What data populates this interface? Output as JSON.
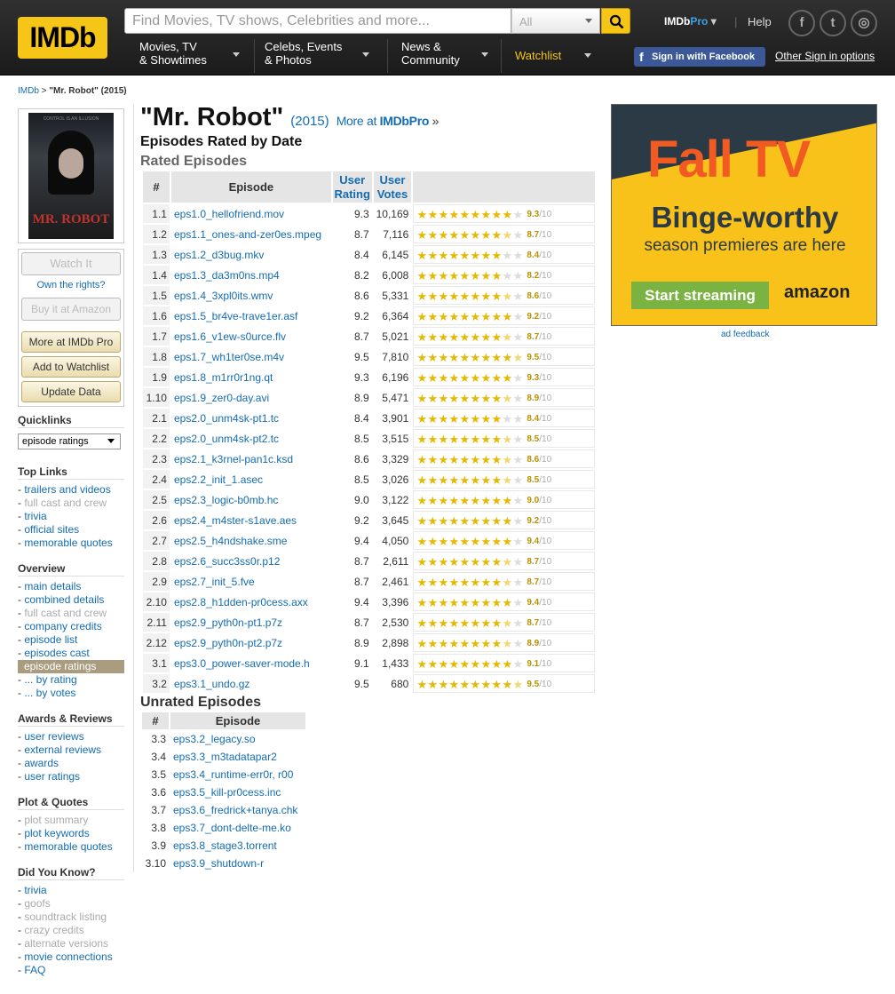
{
  "header": {
    "logo": "IMDb",
    "search_placeholder": "Find Movies, TV shows, Celebrities and more...",
    "search_category": "All",
    "nav": [
      {
        "line1": "Movies, TV",
        "line2": "& Showtimes"
      },
      {
        "line1": "Celebs, Events",
        "line2": "& Photos"
      },
      {
        "line1": "News &",
        "line2": "Community"
      },
      {
        "line1": "Watchlist",
        "line2": ""
      }
    ],
    "pro_a": "IMDb",
    "pro_b": "Pro",
    "help": "Help",
    "facebook_signin": "Sign in with Facebook",
    "other_signin": "Other Sign in options",
    "brand_color": "#f5c518"
  },
  "breadcrumb": {
    "home": "IMDb",
    "sep": " > ",
    "current": "\"Mr. Robot\" (2015)"
  },
  "poster": {
    "title": "MR. ROBOT",
    "tagline": "CONTROL IS AN ILLUSION"
  },
  "sidebar": {
    "watch_it": "Watch It",
    "own_rights": "Own the rights?",
    "buy_amazon": "Buy it at Amazon",
    "more_pro": "More at IMDb Pro",
    "add_watchlist": "Add to Watchlist",
    "update_data": "Update Data",
    "quicklinks_title": "Quicklinks",
    "quicklinks_value": "episode ratings",
    "top_links_title": "Top Links",
    "top_links": [
      {
        "label": "trailers and videos",
        "dim": false
      },
      {
        "label": "full cast and crew",
        "dim": true
      },
      {
        "label": "trivia",
        "dim": false
      },
      {
        "label": "official sites",
        "dim": false
      },
      {
        "label": "memorable quotes",
        "dim": false
      }
    ],
    "overview_title": "Overview",
    "overview": [
      {
        "label": "main details",
        "dim": false
      },
      {
        "label": "combined details",
        "dim": false
      },
      {
        "label": "full cast and crew",
        "dim": true
      },
      {
        "label": "company credits",
        "dim": false
      },
      {
        "label": "episode list",
        "dim": false
      },
      {
        "label": "episodes cast",
        "dim": false
      },
      {
        "label": "episode ratings",
        "dim": false,
        "selected": true
      },
      {
        "label": "... by rating",
        "dim": false,
        "indent": true
      },
      {
        "label": "... by votes",
        "dim": false,
        "indent": true
      }
    ],
    "awards_title": "Awards & Reviews",
    "awards": [
      {
        "label": "user reviews",
        "dim": false
      },
      {
        "label": "external reviews",
        "dim": false
      },
      {
        "label": "awards",
        "dim": false
      },
      {
        "label": "user ratings",
        "dim": false
      }
    ],
    "plot_title": "Plot & Quotes",
    "plot": [
      {
        "label": "plot summary",
        "dim": true
      },
      {
        "label": "plot keywords",
        "dim": false
      },
      {
        "label": "memorable quotes",
        "dim": false
      }
    ],
    "dyk_title": "Did You Know?",
    "dyk": [
      {
        "label": "trivia",
        "dim": false
      },
      {
        "label": "goofs",
        "dim": true
      },
      {
        "label": "soundtrack listing",
        "dim": true
      },
      {
        "label": "crazy credits",
        "dim": true
      },
      {
        "label": "alternate versions",
        "dim": true
      },
      {
        "label": "movie connections",
        "dim": false
      },
      {
        "label": "FAQ",
        "dim": false
      }
    ]
  },
  "main": {
    "title": "\"Mr. Robot\"",
    "year": "(2015)",
    "more_at": "More at ",
    "more_pro": "IMDbPro",
    "more_arrow": " »",
    "subtitle": "Episodes Rated by Date",
    "rated_heading": "Rated Episodes",
    "rated_headers": {
      "num": "#",
      "episode": "Episode",
      "rating": "User Rating",
      "votes": "User Votes"
    },
    "rated": [
      {
        "num": "1.1",
        "title": "eps1.0_hellofriend.mov",
        "rating": "9.3",
        "votes": "10,169"
      },
      {
        "num": "1.2",
        "title": "eps1.1_ones-and-zer0es.mpeg",
        "rating": "8.7",
        "votes": "7,116"
      },
      {
        "num": "1.3",
        "title": "eps1.2_d3bug.mkv",
        "rating": "8.4",
        "votes": "6,145"
      },
      {
        "num": "1.4",
        "title": "eps1.3_da3m0ns.mp4",
        "rating": "8.2",
        "votes": "6,008"
      },
      {
        "num": "1.5",
        "title": "eps1.4_3xpl0its.wmv",
        "rating": "8.6",
        "votes": "5,331"
      },
      {
        "num": "1.6",
        "title": "eps1.5_br4ve-trave1er.asf",
        "rating": "9.2",
        "votes": "6,364"
      },
      {
        "num": "1.7",
        "title": "eps1.6_v1ew-s0urce.flv",
        "rating": "8.7",
        "votes": "5,021"
      },
      {
        "num": "1.8",
        "title": "eps1.7_wh1ter0se.m4v",
        "rating": "9.5",
        "votes": "7,810"
      },
      {
        "num": "1.9",
        "title": "eps1.8_m1rr0r1ng.qt",
        "rating": "9.3",
        "votes": "6,196"
      },
      {
        "num": "1.10",
        "title": "eps1.9_zer0-day.avi",
        "rating": "8.9",
        "votes": "5,471"
      },
      {
        "num": "2.1",
        "title": "eps2.0_unm4sk-pt1.tc",
        "rating": "8.4",
        "votes": "3,901"
      },
      {
        "num": "2.2",
        "title": "eps2.0_unm4sk-pt2.tc",
        "rating": "8.5",
        "votes": "3,515"
      },
      {
        "num": "2.3",
        "title": "eps2.1_k3rnel-pan1c.ksd",
        "rating": "8.6",
        "votes": "3,329"
      },
      {
        "num": "2.4",
        "title": "eps2.2_init_1.asec",
        "rating": "8.5",
        "votes": "3,026"
      },
      {
        "num": "2.5",
        "title": "eps2.3_logic-b0mb.hc",
        "rating": "9.0",
        "votes": "3,122"
      },
      {
        "num": "2.6",
        "title": "eps2.4_m4ster-s1ave.aes",
        "rating": "9.2",
        "votes": "3,645"
      },
      {
        "num": "2.7",
        "title": "eps2.5_h4ndshake.sme",
        "rating": "9.4",
        "votes": "4,050"
      },
      {
        "num": "2.8",
        "title": "eps2.6_succ3ss0r.p12",
        "rating": "8.7",
        "votes": "2,611"
      },
      {
        "num": "2.9",
        "title": "eps2.7_init_5.fve",
        "rating": "8.7",
        "votes": "2,461"
      },
      {
        "num": "2.10",
        "title": "eps2.8_h1dden-pr0cess.axx",
        "rating": "9.4",
        "votes": "3,396"
      },
      {
        "num": "2.11",
        "title": "eps2.9_pyth0n-pt1.p7z",
        "rating": "8.7",
        "votes": "2,530"
      },
      {
        "num": "2.12",
        "title": "eps2.9_pyth0n-pt2.p7z",
        "rating": "8.9",
        "votes": "2,898"
      },
      {
        "num": "3.1",
        "title": "eps3.0_power-saver-mode.h",
        "rating": "9.1",
        "votes": "1,433"
      },
      {
        "num": "3.2",
        "title": "eps3.1_undo.gz",
        "rating": "9.5",
        "votes": "680"
      }
    ],
    "rating_scale": "/10",
    "unrated_heading": "Unrated Episodes",
    "unrated_headers": {
      "num": "#",
      "episode": "Episode"
    },
    "unrated": [
      {
        "num": "3.3",
        "title": "eps3.2_legacy.so"
      },
      {
        "num": "3.4",
        "title": "eps3.3_m3tadatapar2"
      },
      {
        "num": "3.5",
        "title": "eps3.4_runtime-err0r, r00"
      },
      {
        "num": "3.6",
        "title": "eps3.5_kill-pr0cess.inc"
      },
      {
        "num": "3.7",
        "title": "eps3.6_fredrick+tanya.chk"
      },
      {
        "num": "3.8",
        "title": "eps3.7_dont-delte-me.ko"
      },
      {
        "num": "3.9",
        "title": "eps3.8_stage3.torrent"
      },
      {
        "num": "3.10",
        "title": "eps3.9_shutdown-r"
      }
    ]
  },
  "ad": {
    "line1": "Fall TV",
    "line2": "Binge-worthy",
    "line3": "season premieres are here",
    "cta": "Start streaming",
    "brand": "amazon",
    "feedback": "ad feedback"
  }
}
